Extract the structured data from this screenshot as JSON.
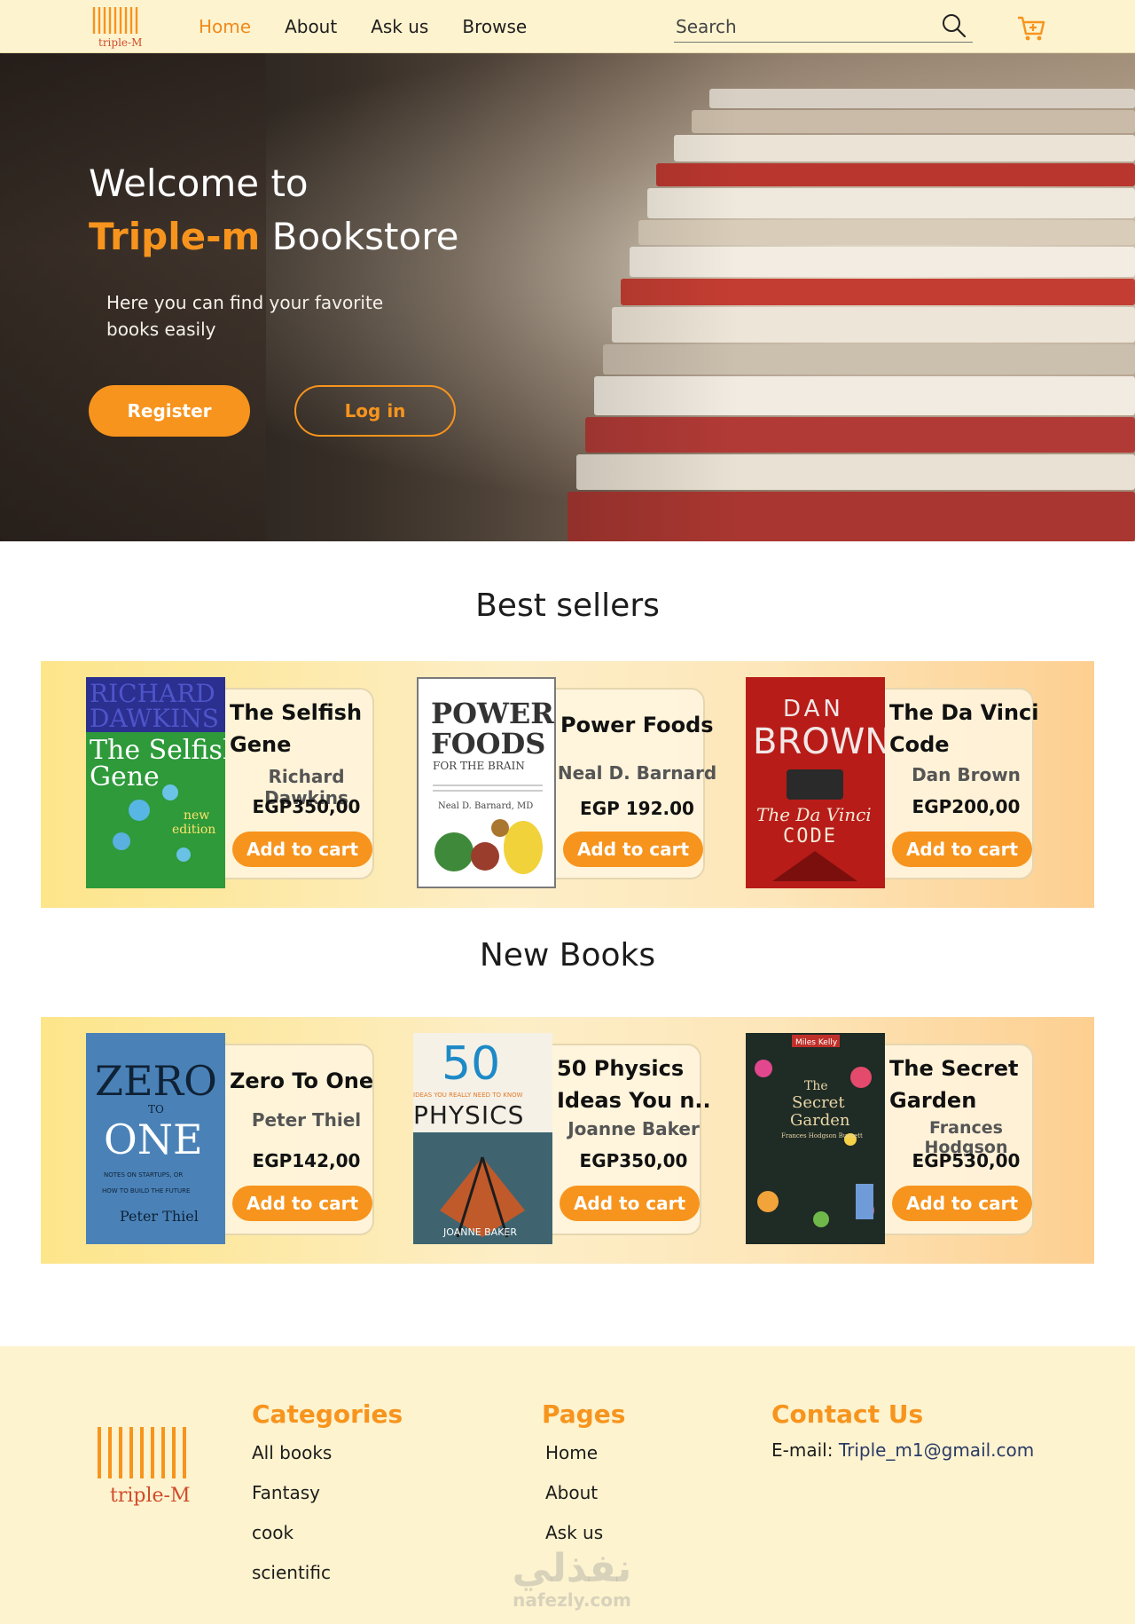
{
  "header": {
    "logo_text": "triple-M",
    "nav": [
      {
        "label": "Home",
        "active": true
      },
      {
        "label": "About",
        "active": false
      },
      {
        "label": "Ask us",
        "active": false
      },
      {
        "label": "Browse",
        "active": false
      }
    ],
    "search_placeholder": "Search",
    "icons": [
      "search-icon",
      "cart-icon"
    ]
  },
  "hero": {
    "title_line1": "Welcome to",
    "brand": "Triple-m",
    "title_line2_rest": " Bookstore",
    "subtitle": "Here you can find your favorite books easily",
    "register_label": "Register",
    "login_label": "Log in"
  },
  "best_sellers": {
    "title": "Best sellers",
    "books": [
      {
        "title": "The Selfish Gene",
        "author": "Richard Dawkins",
        "price": "EGP350,00",
        "button": "Add to cart",
        "cover": {
          "lines": [
            "RICHARD",
            "DAWKINS",
            "The Selfish",
            "Gene",
            "new",
            "edition"
          ]
        }
      },
      {
        "title": "Power Foods",
        "author": "Neal D. Barnard",
        "price": "EGP 192.00",
        "button": "Add to cart",
        "cover": {
          "lines": [
            "POWER",
            "FOODS",
            "FOR THE BRAIN",
            "Neal D. Barnard, MD"
          ]
        }
      },
      {
        "title": "The Da Vinci Code",
        "author": "Dan Brown",
        "price": "EGP200,00",
        "button": "Add to cart",
        "cover": {
          "lines": [
            "DAN",
            "BROWN",
            "The Da Vinci",
            "CODE"
          ]
        }
      }
    ]
  },
  "new_books": {
    "title": "New Books",
    "books": [
      {
        "title": "Zero To One",
        "author": "Peter Thiel",
        "price": "EGP142,00",
        "button": "Add to cart",
        "cover": {
          "lines": [
            "ZERO",
            "TO",
            "ONE",
            "NOTES ON STARTUPS, OR",
            "HOW TO BUILD THE FUTURE",
            "Peter Thiel"
          ]
        }
      },
      {
        "title": "50 Physics Ideas You n..",
        "author": "Joanne Baker",
        "price": "EGP350,00",
        "button": "Add to cart",
        "cover": {
          "lines": [
            "50",
            "IDEAS YOU REALLY NEED TO KNOW",
            "PHYSICS",
            "JOANNE BAKER"
          ]
        }
      },
      {
        "title": "The Secret Garden",
        "author": "Frances Hodgson",
        "price": "EGP530,00",
        "button": "Add to cart",
        "cover": {
          "lines": [
            "Miles Kelly",
            "The",
            "Secret",
            "Garden",
            "Frances Hodgson Burnett"
          ]
        }
      }
    ]
  },
  "footer": {
    "logo_text": "triple-M",
    "categories": {
      "title": "Categories",
      "items": [
        "All books",
        "Fantasy",
        "cook",
        "scientific"
      ]
    },
    "pages": {
      "title": "Pages",
      "items": [
        "Home",
        "About",
        "Ask us"
      ]
    },
    "contact": {
      "title": "Contact Us",
      "label": "E-mail: ",
      "email": "Triple_m1@gmail.com"
    },
    "watermark": {
      "arabic": "نفذلي",
      "latin": "nafezly.com"
    }
  },
  "colors": {
    "accent": "#f7941d",
    "header_bg": "#fdf3cf",
    "band_start": "#fde58a",
    "band_end": "#fdcf91"
  }
}
